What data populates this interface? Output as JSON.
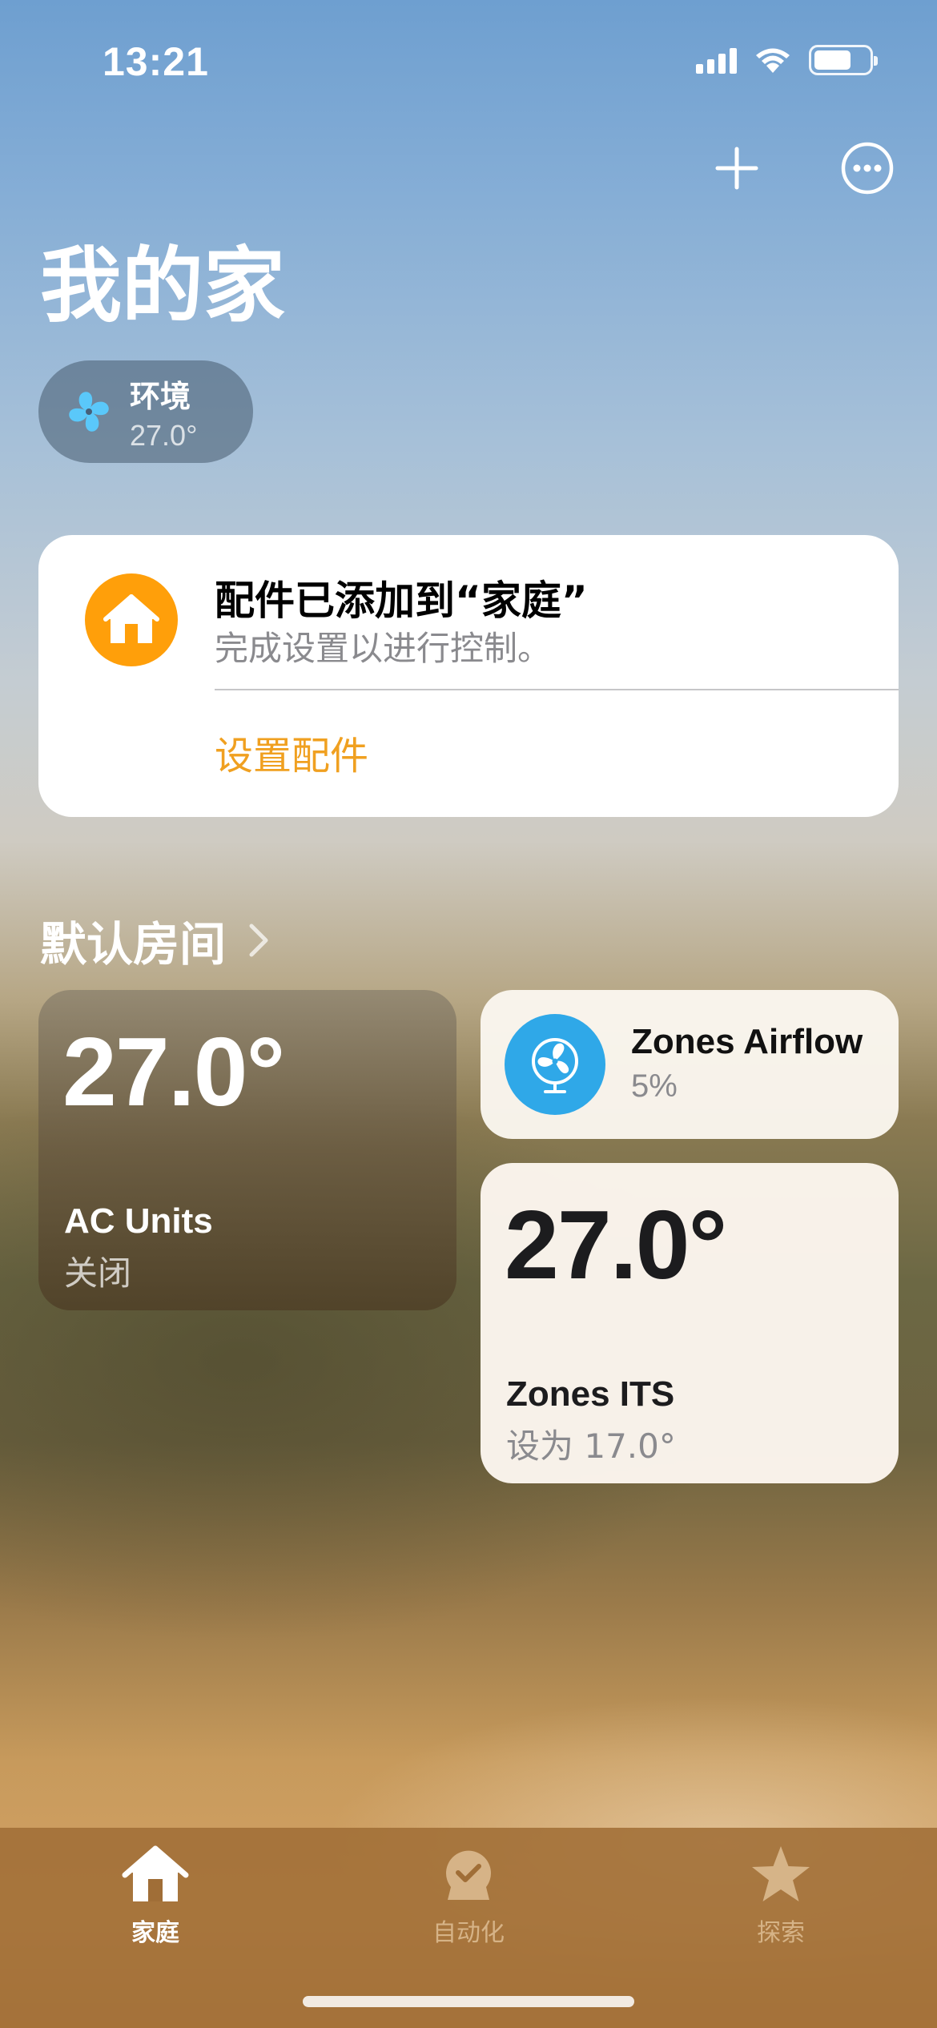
{
  "status_bar": {
    "time": "13:21",
    "battery_level": 0.68
  },
  "header": {
    "title": "我的家",
    "add_icon": "plus-icon",
    "more_icon": "ellipsis-circle-icon"
  },
  "environment": {
    "label": "环境",
    "value": "27.0°",
    "icon": "fan-icon",
    "icon_color": "#5ac8fa"
  },
  "notification": {
    "title": "配件已添加到“家庭”",
    "subtitle": "完成设置以进行控制。",
    "action": "设置配件",
    "icon": "house-icon",
    "accent_color": "#ff9f0a"
  },
  "room": {
    "name": "默认房间",
    "tiles": [
      {
        "temperature": "27.0°",
        "name": "AC Units",
        "state": "关闭"
      },
      {
        "name": "Zones Airflow",
        "state": "5%",
        "icon": "fan-icon",
        "icon_color": "#2fa8e8"
      },
      {
        "temperature": "27.0°",
        "name": "Zones ITS",
        "state": "设为 17.0°"
      }
    ]
  },
  "tab_bar": {
    "tabs": [
      {
        "label": "家庭",
        "icon": "house-icon",
        "active": true
      },
      {
        "label": "自动化",
        "icon": "clock-check-icon",
        "active": false
      },
      {
        "label": "探索",
        "icon": "star-icon",
        "active": false
      }
    ]
  }
}
